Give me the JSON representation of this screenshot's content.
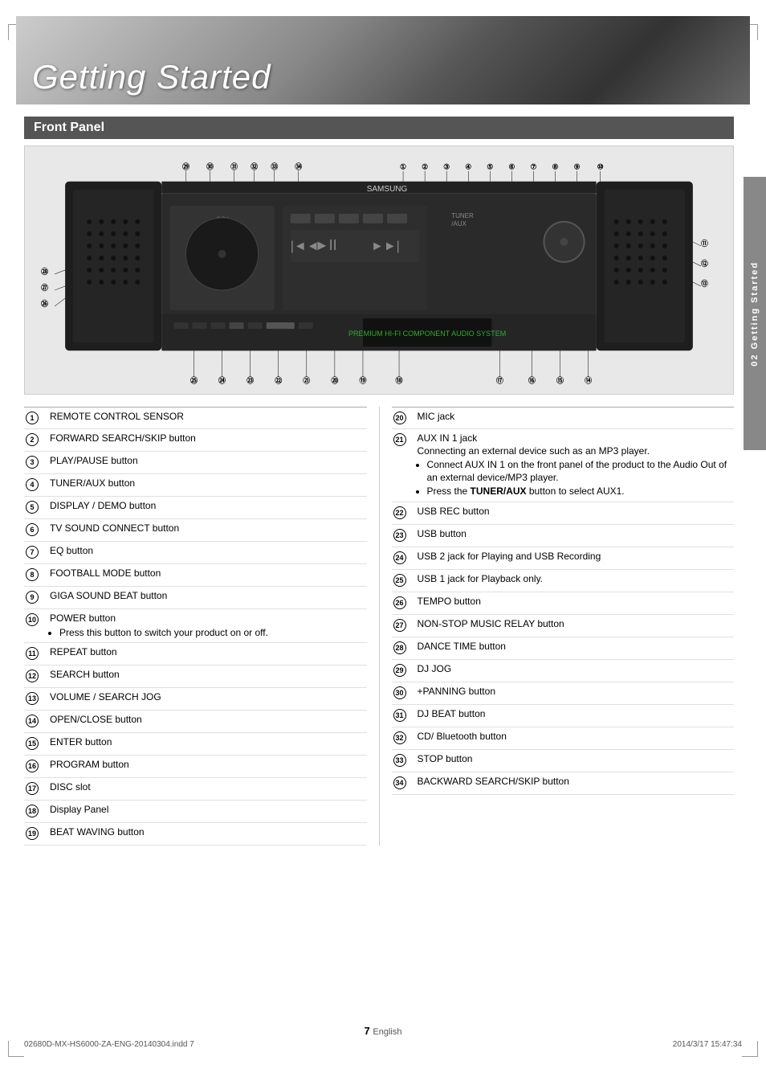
{
  "page": {
    "title": "Getting Started",
    "section": "Front Panel",
    "page_number": "7",
    "page_number_suffix": "English",
    "footer_left": "02680D-MX-HS6000-ZA-ENG-20140304.indd   7",
    "footer_right": "2014/3/17   15:47:34",
    "chapter": "02   Getting Started"
  },
  "table_left": [
    {
      "num": "1",
      "desc": "REMOTE CONTROL SENSOR"
    },
    {
      "num": "2",
      "desc": "FORWARD SEARCH/SKIP button"
    },
    {
      "num": "3",
      "desc": "PLAY/PAUSE button"
    },
    {
      "num": "4",
      "desc": "TUNER/AUX button"
    },
    {
      "num": "5",
      "desc": "DISPLAY / DEMO button"
    },
    {
      "num": "6",
      "desc": "TV SOUND CONNECT button"
    },
    {
      "num": "7",
      "desc": "EQ button"
    },
    {
      "num": "8",
      "desc": "FOOTBALL MODE button"
    },
    {
      "num": "9",
      "desc": "GIGA SOUND BEAT button"
    },
    {
      "num": "10",
      "desc": "POWER button\n• Press this button to switch your product on or off.",
      "has_bullet": true,
      "bullet": "Press this button to switch your product on or off."
    },
    {
      "num": "11",
      "desc": "REPEAT button"
    },
    {
      "num": "12",
      "desc": "SEARCH button"
    },
    {
      "num": "13",
      "desc": "VOLUME / SEARCH JOG"
    },
    {
      "num": "14",
      "desc": "OPEN/CLOSE button"
    },
    {
      "num": "15",
      "desc": "ENTER button"
    },
    {
      "num": "16",
      "desc": "PROGRAM button"
    },
    {
      "num": "17",
      "desc": "DISC slot"
    },
    {
      "num": "18",
      "desc": "Display Panel"
    },
    {
      "num": "19",
      "desc": "BEAT WAVING button"
    }
  ],
  "table_right": [
    {
      "num": "20",
      "desc": "MIC jack"
    },
    {
      "num": "21",
      "desc": "AUX IN 1 jack\nConnecting an external device such as an MP3 player.\n• Connect AUX IN 1 on the front panel of the product to the Audio Out of an external device/MP3 player.\n• Press the TUNER/AUX button to select  AUX1.",
      "complex": true,
      "title": "AUX IN 1 jack",
      "subtitle": "Connecting an external device such as an MP3 player.",
      "bullets": [
        "Connect AUX IN 1 on the front panel of the product to the Audio Out of an external device/MP3 player.",
        "Press the TUNER/AUX button to select  AUX1."
      ],
      "bold_in_bullet1": "",
      "bold_in_bullet2": "TUNER/AUX"
    },
    {
      "num": "22",
      "desc": "USB REC button"
    },
    {
      "num": "23",
      "desc": "USB button"
    },
    {
      "num": "24",
      "desc": "USB 2 jack for Playing and USB Recording"
    },
    {
      "num": "25",
      "desc": "USB 1 jack for Playback only."
    },
    {
      "num": "26",
      "desc": "TEMPO button"
    },
    {
      "num": "27",
      "desc": "NON-STOP MUSIC RELAY button"
    },
    {
      "num": "28",
      "desc": "DANCE TIME button"
    },
    {
      "num": "29",
      "desc": "DJ JOG"
    },
    {
      "num": "30",
      "desc": "+PANNING button"
    },
    {
      "num": "31",
      "desc": "DJ BEAT button"
    },
    {
      "num": "32",
      "desc": "CD/ Bluetooth button"
    },
    {
      "num": "33",
      "desc": "STOP button"
    },
    {
      "num": "34",
      "desc": "BACKWARD SEARCH/SKIP button"
    }
  ]
}
